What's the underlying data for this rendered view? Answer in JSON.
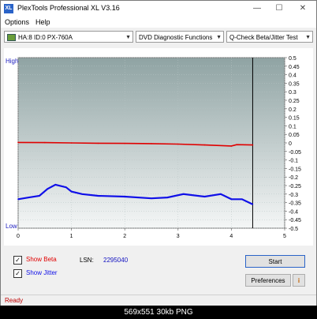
{
  "window": {
    "title": "PlexTools Professional XL V3.16",
    "app_icon_text": "XL"
  },
  "menu": {
    "items": [
      "Options",
      "Help"
    ]
  },
  "toolbar": {
    "drive": "HA:8 ID:0  PX-760A",
    "function": "DVD Diagnostic Functions",
    "test": "Q-Check Beta/Jitter Test"
  },
  "chart_data": {
    "type": "line",
    "left_axis_top_label": "High",
    "left_axis_bottom_label": "Low",
    "x_ticks": [
      "0",
      "1",
      "2",
      "3",
      "4",
      "5"
    ],
    "xlim": [
      0,
      5
    ],
    "y_ticks": [
      "0.5",
      "0.45",
      "0.4",
      "0.35",
      "0.3",
      "0.25",
      "0.2",
      "0.15",
      "0.1",
      "0.05",
      "0",
      "-0.05",
      "-0.1",
      "-0.15",
      "-0.2",
      "-0.25",
      "-0.3",
      "-0.35",
      "-0.4",
      "-0.45",
      "-0.5"
    ],
    "ylim": [
      -0.5,
      0.5
    ],
    "end_marker_x": 4.4,
    "series": [
      {
        "color": "#e00000",
        "x": [
          0,
          0.5,
          1.0,
          1.5,
          2.0,
          2.5,
          3.0,
          3.5,
          4.0,
          4.1,
          4.4
        ],
        "y": [
          0.003,
          0.002,
          0.0,
          -0.002,
          -0.003,
          -0.004,
          -0.007,
          -0.012,
          -0.018,
          -0.01,
          -0.012
        ]
      },
      {
        "color": "#1010e8",
        "x": [
          0,
          0.2,
          0.4,
          0.55,
          0.7,
          0.9,
          1.0,
          1.2,
          1.5,
          2.0,
          2.5,
          2.8,
          3.1,
          3.5,
          3.8,
          4.0,
          4.2,
          4.4
        ],
        "y": [
          -0.33,
          -0.32,
          -0.31,
          -0.27,
          -0.245,
          -0.26,
          -0.285,
          -0.3,
          -0.31,
          -0.315,
          -0.325,
          -0.32,
          -0.3,
          -0.315,
          -0.3,
          -0.33,
          -0.33,
          -0.36
        ]
      }
    ]
  },
  "options": {
    "show_beta": {
      "label": "Show Beta",
      "checked": true
    },
    "show_jitter": {
      "label": "Show Jitter",
      "checked": true
    },
    "lsn_label": "LSN:",
    "lsn_value": "2295040"
  },
  "buttons": {
    "start": "Start",
    "preferences": "Preferences",
    "info_icon": "i"
  },
  "status": {
    "text": "Ready"
  },
  "caption": {
    "text": "569x551  30kb  PNG"
  },
  "colors": {
    "beta": "#e00000",
    "jitter": "#1010e8",
    "plot_bg_top": "#8fa3a3",
    "plot_bg_bottom": "#f4f6f6",
    "status": "#c00000"
  }
}
